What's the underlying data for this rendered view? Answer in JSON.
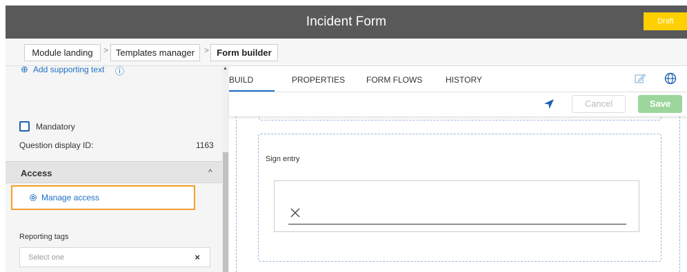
{
  "header": {
    "title": "Incident Form",
    "status_badge": "Draft"
  },
  "breadcrumb": {
    "items": [
      {
        "label": "Module landing"
      },
      {
        "label": "Templates manager"
      },
      {
        "label": "Form builder"
      }
    ],
    "separator": ">"
  },
  "left_panel": {
    "add_supporting_text": "Add supporting text",
    "add_icon": "⊕",
    "info_icon": "ⓘ",
    "mandatory_label": "Mandatory",
    "question_display_id_label": "Question display ID:",
    "question_display_id_value": "1163",
    "access_section_title": "Access",
    "access_chevron": "^",
    "manage_access_label": "Manage access",
    "reporting_tags_label": "Reporting tags",
    "reporting_tags_placeholder": "Select one",
    "reporting_tags_clear": "×"
  },
  "tabs": [
    {
      "label": "BUILD",
      "active": true
    },
    {
      "label": "PROPERTIES",
      "active": false
    },
    {
      "label": "FORM FLOWS",
      "active": false
    },
    {
      "label": "HISTORY",
      "active": false
    }
  ],
  "actions": {
    "cancel_label": "Cancel",
    "save_label": "Save"
  },
  "form": {
    "sign_entry_label": "Sign entry"
  },
  "colors": {
    "header_bg": "#595959",
    "draft_badge": "#ffd000",
    "accent_blue": "#1c6fc4",
    "highlight_orange": "#f29f2b",
    "save_green": "#9cd69c"
  },
  "icons": [
    "add-circle-icon",
    "info-icon",
    "gear-icon",
    "edit-icon",
    "globe-icon",
    "navigation-arrow-icon",
    "close-icon",
    "chevron-up-icon"
  ]
}
